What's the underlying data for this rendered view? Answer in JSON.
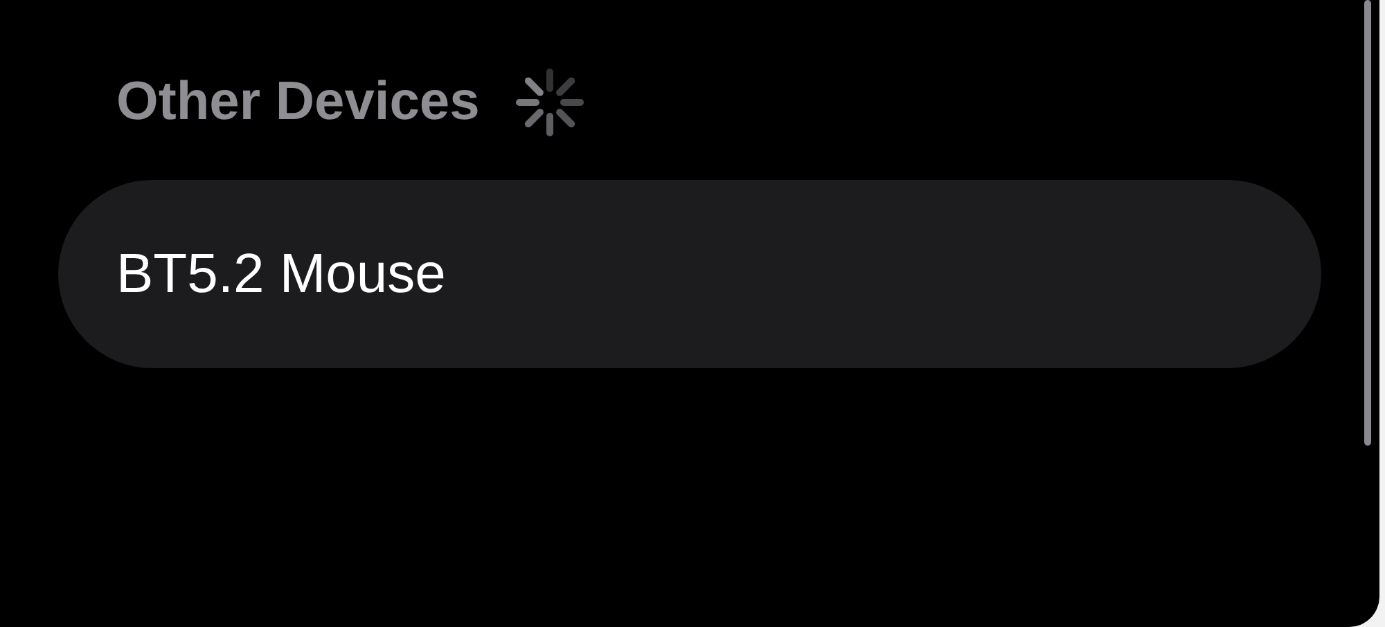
{
  "section": {
    "title": "Other Devices",
    "loading": true
  },
  "devices": [
    {
      "name": "BT5.2 Mouse"
    }
  ]
}
